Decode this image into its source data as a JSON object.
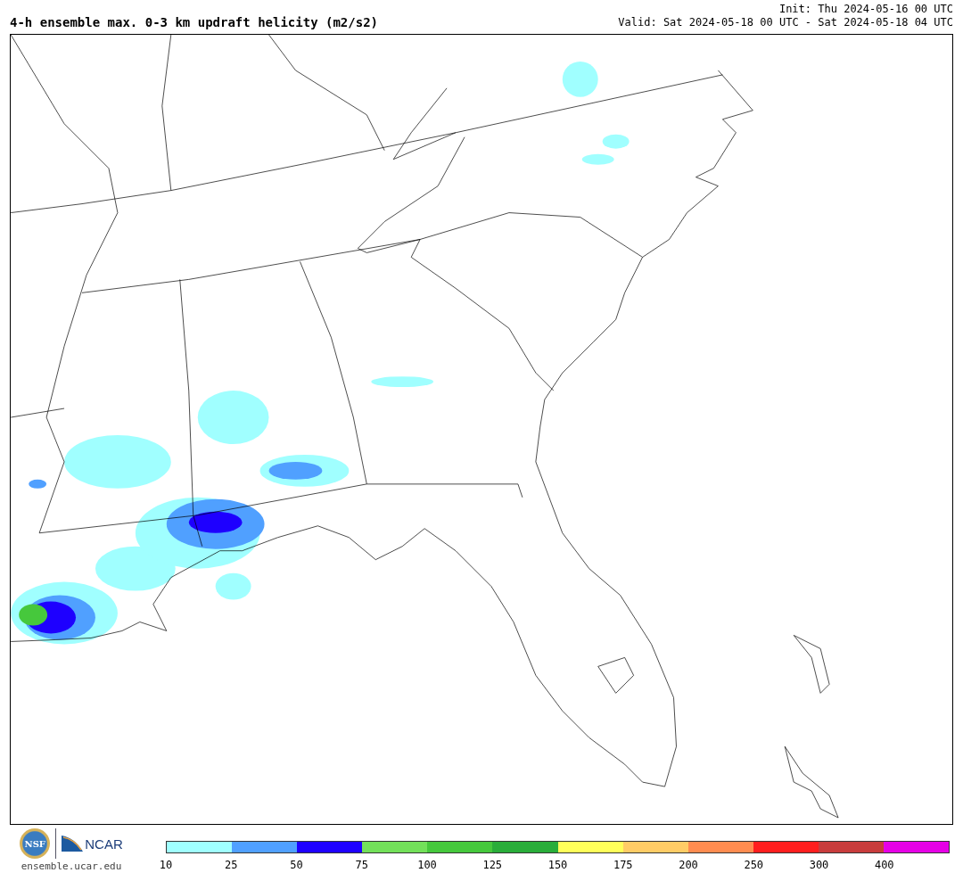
{
  "header": {
    "title": "4-h ensemble max. 0-3 km updraft helicity (m2/s2)",
    "init": "Init: Thu 2024-05-16 00 UTC",
    "valid": "Valid: Sat 2024-05-18 00 UTC - Sat 2024-05-18 04 UTC"
  },
  "footer": {
    "nsf_logo": "NSF",
    "ncar_logo": "NCAR",
    "site": "ensemble.ucar.edu"
  },
  "legend": {
    "bins": [
      {
        "label": "10",
        "color": "#a0ffff"
      },
      {
        "label": "25",
        "color": "#50a0ff"
      },
      {
        "label": "50",
        "color": "#1e00ff"
      },
      {
        "label": "75",
        "color": "#73e05a"
      },
      {
        "label": "100",
        "color": "#46c83c"
      },
      {
        "label": "125",
        "color": "#2aad3a"
      },
      {
        "label": "150",
        "color": "#ffff5a"
      },
      {
        "label": "175",
        "color": "#ffcc66"
      },
      {
        "label": "200",
        "color": "#ff8c50"
      },
      {
        "label": "250",
        "color": "#ff1e1e"
      },
      {
        "label": "300",
        "color": "#c83c3c"
      },
      {
        "label": "400",
        "color": "#e600e6"
      }
    ]
  }
}
